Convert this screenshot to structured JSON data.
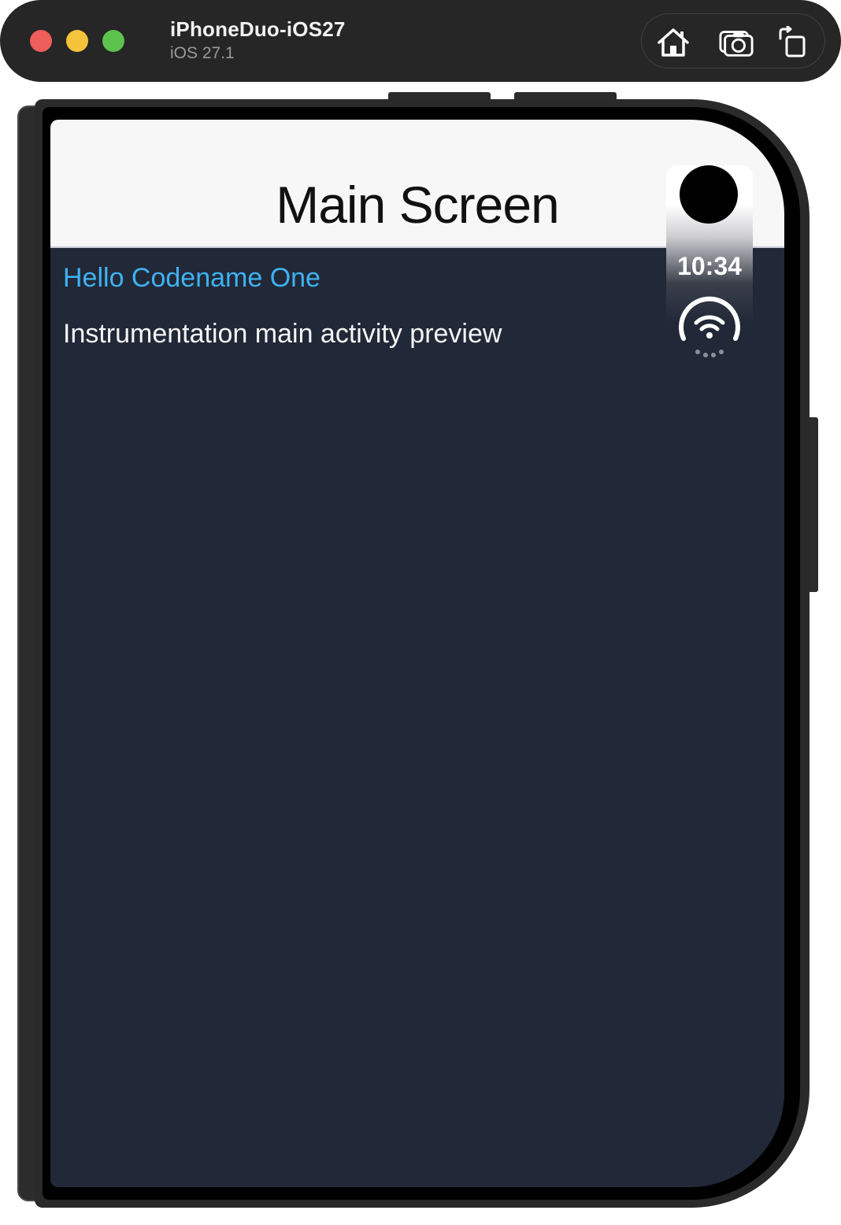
{
  "simulator": {
    "device_name": "iPhoneDuo-iOS27",
    "os_version": "iOS 27.1",
    "toolbar": {
      "home_icon": "home-icon",
      "screenshot_icon": "camera-icon",
      "rotate_icon": "rotate-icon"
    },
    "window_controls": {
      "close_color": "#ee5f5b",
      "minimize_color": "#f5c33b",
      "maximize_color": "#5ec24f"
    }
  },
  "status_bar": {
    "time": "10:34",
    "wifi_icon": "wifi-icon"
  },
  "app": {
    "nav_title": "Main Screen",
    "hello_label": "Hello Codename One",
    "description_label": "Instrumentation main activity preview",
    "colors": {
      "background": "#212837",
      "accent": "#3fb2f1",
      "navbar": "#f7f7f7"
    }
  }
}
